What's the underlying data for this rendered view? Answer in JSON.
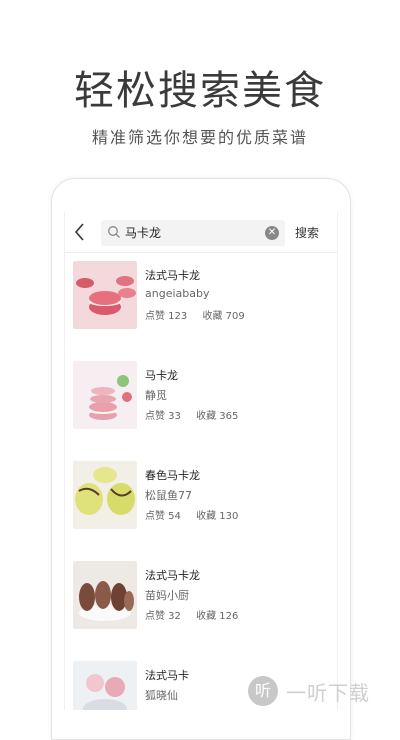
{
  "headline": "轻松搜索美食",
  "subline": "精准筛选你想要的优质菜谱",
  "search": {
    "query": "马卡龙",
    "button_label": "搜索"
  },
  "results": [
    {
      "title": "法式马卡龙",
      "author": "angeiababy",
      "likes_label": "点赞 123",
      "saves_label": "收藏 709"
    },
    {
      "title": "马卡龙",
      "author": "静觅",
      "likes_label": "点赞 33",
      "saves_label": "收藏 365"
    },
    {
      "title": "春色马卡龙",
      "author": "松鼠鱼77",
      "likes_label": "点赞 54",
      "saves_label": "收藏 130"
    },
    {
      "title": "法式马卡龙",
      "author": "苗妈小厨",
      "likes_label": "点赞 32",
      "saves_label": "收藏 126"
    },
    {
      "title": "法式马卡",
      "author": "狐晓仙",
      "likes_label": "",
      "saves_label": ""
    }
  ],
  "watermark": {
    "icon_glyph": "听",
    "text": "一听下载"
  }
}
